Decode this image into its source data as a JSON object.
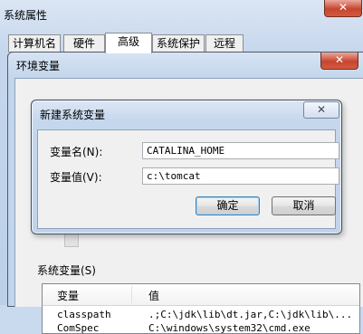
{
  "system_properties": {
    "title": "系统属性",
    "tabs": [
      {
        "label": "计算机名"
      },
      {
        "label": "硬件"
      },
      {
        "label": "高级"
      },
      {
        "label": "系统保护"
      },
      {
        "label": "远程"
      }
    ],
    "active_tab": "高级"
  },
  "environment_variables": {
    "title": "环境变量",
    "system_vars_label": "系统变量(S)",
    "columns": [
      "变量",
      "值"
    ],
    "rows": [
      {
        "name": "classpath",
        "value": ".;C:\\jdk\\lib\\dt.jar,C:\\jdk\\lib\\..."
      },
      {
        "name": "ComSpec",
        "value": "C:\\windows\\system32\\cmd.exe"
      }
    ]
  },
  "new_var_dialog": {
    "title": "新建系统变量",
    "name_label": "变量名(N):",
    "name_value": "CATALINA_HOME",
    "value_label": "变量值(V):",
    "value_value": "c:\\tomcat",
    "ok_label": "确定",
    "cancel_label": "取消"
  },
  "colors": {
    "close_button": "#c7452f",
    "window_frame": "#c3d5eb"
  }
}
